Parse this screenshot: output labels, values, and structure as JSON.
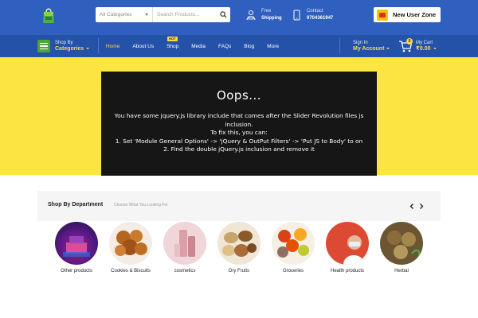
{
  "header": {
    "search": {
      "category_select": "All Categories",
      "placeholder": "Search Products..."
    },
    "shipping": {
      "line1": "Free",
      "line2": "Shipping"
    },
    "contact": {
      "line1": "Contact",
      "line2": "9704361947"
    },
    "user_zone": "New User Zone"
  },
  "nav": {
    "shop_by": {
      "line1": "Shop By",
      "line2": "Categories"
    },
    "items": [
      {
        "label": "Home",
        "active": true
      },
      {
        "label": "About Us"
      },
      {
        "label": "Shop",
        "badge": "HOT"
      },
      {
        "label": "Media"
      },
      {
        "label": "FAQs"
      },
      {
        "label": "Blog"
      },
      {
        "label": "More"
      }
    ],
    "account": {
      "line1": "Sign In",
      "line2": "My Account"
    },
    "cart": {
      "count": "0",
      "line1": "My Cart",
      "line2": "₹0.00"
    }
  },
  "hero": {
    "title": "Oops...",
    "lines": [
      "You have some jquery.js library include that comes after the Slider Revolution files js",
      "inclusion.",
      "To fix this, you can:",
      "1. Set 'Module General Options' -> 'jQuery & OutPut Filters' -> 'Put JS to Body' to on",
      "2. Find the double jQuery.js inclusion and remove it"
    ]
  },
  "department": {
    "title": "Shop By Department",
    "subtitle": "Choose What You Looking For",
    "categories": [
      {
        "label": "Other products"
      },
      {
        "label": "Cookies & Biscuits"
      },
      {
        "label": "cosmetics"
      },
      {
        "label": "Dry Fruits"
      },
      {
        "label": "Groceries"
      },
      {
        "label": "Health products"
      },
      {
        "label": "Herbal"
      }
    ]
  },
  "colors": {
    "header_blue": "#2f5fbf",
    "nav_blue": "#2452a8",
    "accent_yellow": "#fce540",
    "link_yellow": "#ffd54a",
    "green": "#4fa33a"
  }
}
